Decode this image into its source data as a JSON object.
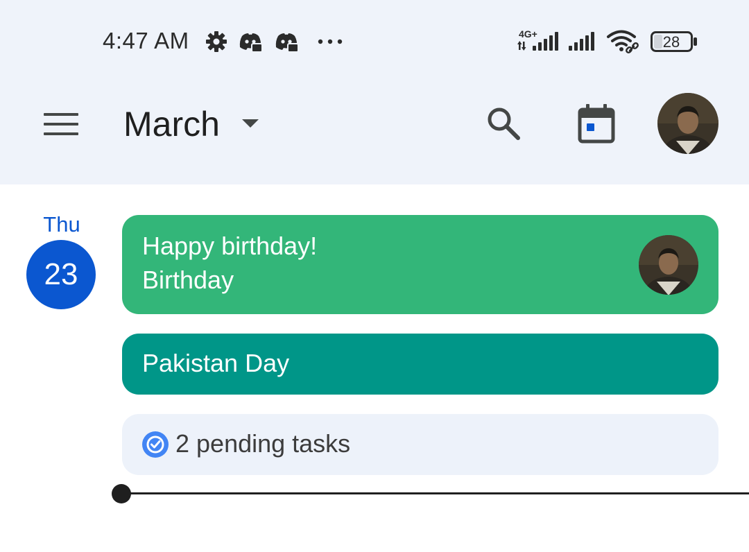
{
  "status_bar": {
    "time": "4:47 AM",
    "network_label": "4G+",
    "battery_level": "28",
    "icons": [
      "gear-icon",
      "discord-icon",
      "discord-icon",
      "more-icon",
      "signal-icon",
      "signal-icon",
      "wifi-icon",
      "battery-icon"
    ]
  },
  "app_bar": {
    "month": "March",
    "icons": [
      "menu-icon",
      "dropdown-caret-icon",
      "search-icon",
      "today-calendar-icon",
      "avatar"
    ]
  },
  "day": {
    "weekday": "Thu",
    "date": "23"
  },
  "events": [
    {
      "title": "Happy birthday!",
      "subtitle": "Birthday",
      "color": "#33b679"
    },
    {
      "title": "Pakistan Day",
      "color": "#009688"
    }
  ],
  "tasks": {
    "label": "2 pending tasks",
    "icon": "task-check-icon"
  },
  "colors": {
    "accent": "#0b57d0",
    "header_bg": "#eff3fa",
    "tasks_bg": "#edf2fa"
  }
}
